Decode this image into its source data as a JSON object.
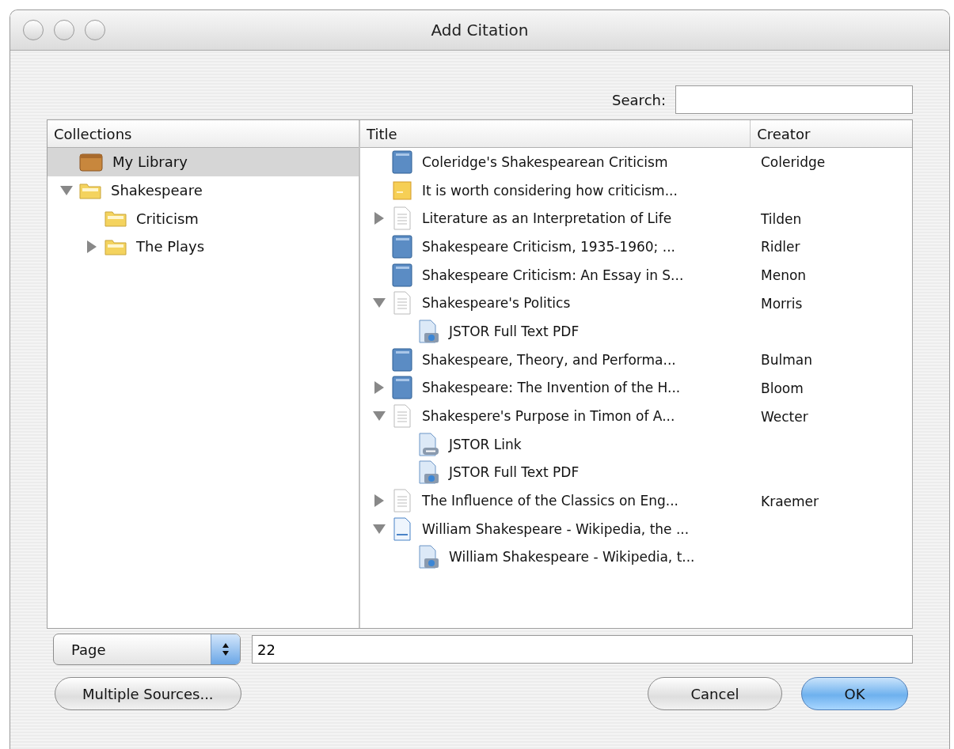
{
  "window": {
    "title": "Add Citation"
  },
  "search": {
    "label": "Search:"
  },
  "collections": {
    "heading": "Collections",
    "items": [
      {
        "label": "My Library",
        "kind": "library",
        "selected": true
      },
      {
        "label": "Shakespeare",
        "kind": "folder",
        "selected": false,
        "expanded": true,
        "children": [
          {
            "label": "Criticism",
            "kind": "folder",
            "selected": false
          },
          {
            "label": "The Plays",
            "kind": "folder",
            "selected": false,
            "expanded": false
          }
        ]
      }
    ]
  },
  "items": {
    "columns": [
      "Title",
      "Creator"
    ],
    "rows": [
      {
        "title": "Coleridge's Shakespearean Criticism",
        "creator": "Coleridge",
        "kind": "book"
      },
      {
        "title": "It is worth considering how criticism...",
        "kind": "note"
      },
      {
        "title": "Literature as an Interpretation of Life",
        "creator": "Tilden",
        "kind": "document",
        "expanded": false
      },
      {
        "title": "Shakespeare Criticism, 1935-1960; ...",
        "creator": "Ridler",
        "kind": "book"
      },
      {
        "title": "Shakespeare Criticism: An Essay in S...",
        "creator": "Menon",
        "kind": "book"
      },
      {
        "title": "Shakespeare's Politics",
        "creator": "Morris",
        "kind": "document",
        "expanded": true,
        "children": [
          {
            "title": "JSTOR Full Text PDF",
            "kind": "pdf"
          }
        ]
      },
      {
        "title": "Shakespeare, Theory, and Performa...",
        "creator": "Bulman",
        "kind": "book"
      },
      {
        "title": "Shakespeare: The Invention of the H...",
        "creator": "Bloom",
        "kind": "book",
        "expanded": false
      },
      {
        "title": "Shakespere's Purpose in Timon of A...",
        "creator": "Wecter",
        "kind": "document",
        "expanded": true,
        "children": [
          {
            "title": "JSTOR Link",
            "kind": "link"
          },
          {
            "title": "JSTOR Full Text PDF",
            "kind": "pdf"
          }
        ]
      },
      {
        "title": "The Influence of the Classics on Eng...",
        "creator": "Kraemer",
        "kind": "document",
        "expanded": false
      },
      {
        "title": "William Shakespeare - Wikipedia, the ...",
        "kind": "webpage",
        "expanded": true,
        "children": [
          {
            "title": "William Shakespeare - Wikipedia, t...",
            "kind": "pdf"
          }
        ]
      }
    ]
  },
  "locator": {
    "type": "Page",
    "value": "22"
  },
  "buttons": {
    "multiple": "Multiple Sources...",
    "cancel": "Cancel",
    "ok": "OK"
  }
}
